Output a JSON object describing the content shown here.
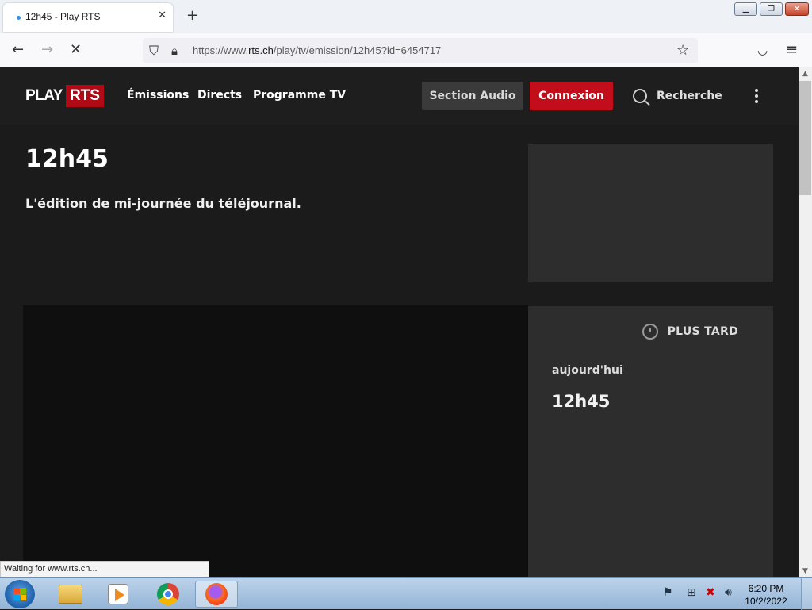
{
  "browser": {
    "tab_title": "12h45 - Play RTS",
    "tab_close": "✕",
    "new_tab": "+",
    "url_prefix": "https://www.",
    "url_domain": "rts.ch",
    "url_rest": "/play/tv/emission/12h45?id=6454717",
    "status": "Waiting for www.rts.ch..."
  },
  "site": {
    "logo_play": "PLAY",
    "logo_rts": "RTS",
    "nav": [
      "Émissions",
      "Directs",
      "Programme TV"
    ],
    "section_audio": "Section Audio",
    "login": "Connexion",
    "search": "Recherche"
  },
  "show": {
    "title": "12h45",
    "description": "L'édition de mi-journée du téléjournal."
  },
  "later": {
    "heading": "PLUS TARD",
    "day": "aujourd'hui",
    "name": "12h45"
  },
  "taskbar": {
    "time": "6:20 PM",
    "date": "10/2/2022"
  },
  "colors": {
    "rts_red": "#c20e1a",
    "page_bg": "#1b1b1b",
    "card_bg": "#2d2d2d"
  }
}
